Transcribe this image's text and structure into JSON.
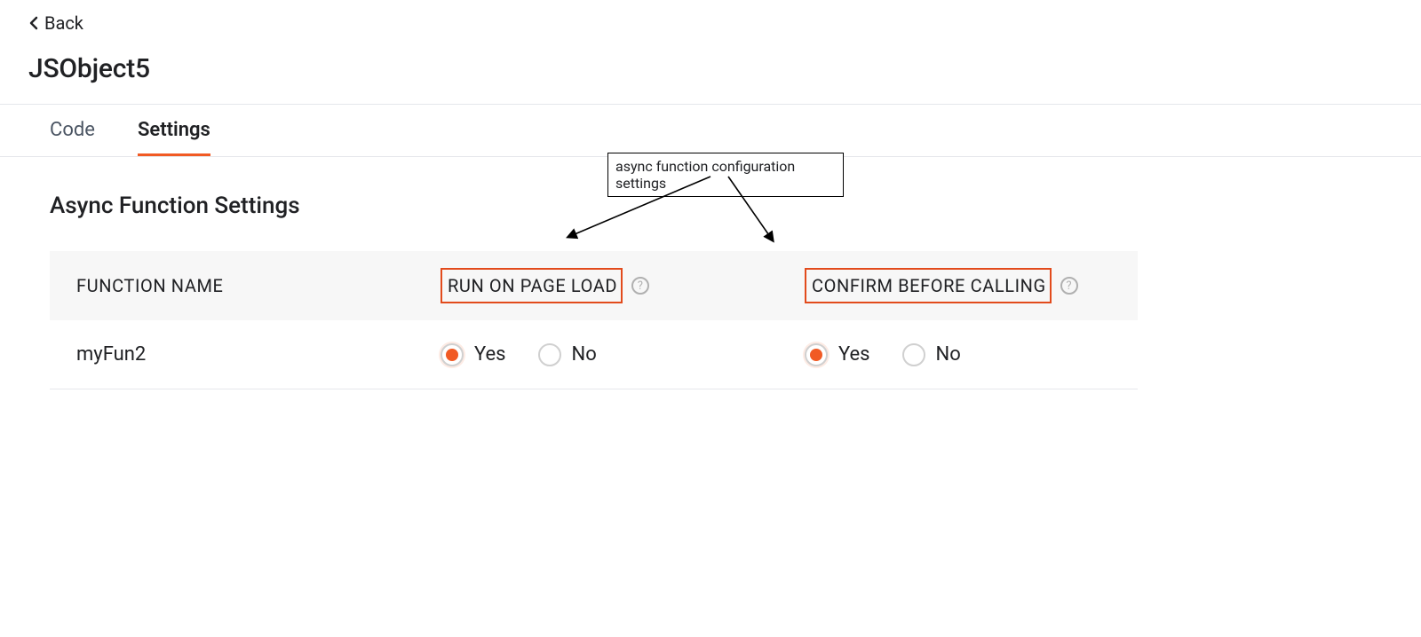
{
  "header": {
    "back_label": "Back",
    "page_title": "JSObject5"
  },
  "tabs": [
    {
      "id": "code",
      "label": "Code",
      "active": false
    },
    {
      "id": "settings",
      "label": "Settings",
      "active": true
    }
  ],
  "section": {
    "title": "Async Function Settings"
  },
  "columns": {
    "function_name": "FUNCTION NAME",
    "run_on_page_load": "RUN ON PAGE LOAD",
    "confirm_before_calling": "CONFIRM BEFORE CALLING"
  },
  "radio_labels": {
    "yes": "Yes",
    "no": "No"
  },
  "rows": [
    {
      "function_name": "myFun2",
      "run_on_page_load": "yes",
      "confirm_before_calling": "yes"
    }
  ],
  "annotation": {
    "text": "async function configuration settings"
  },
  "colors": {
    "accent": "#f15a24",
    "highlight_border": "#e24b1c"
  }
}
